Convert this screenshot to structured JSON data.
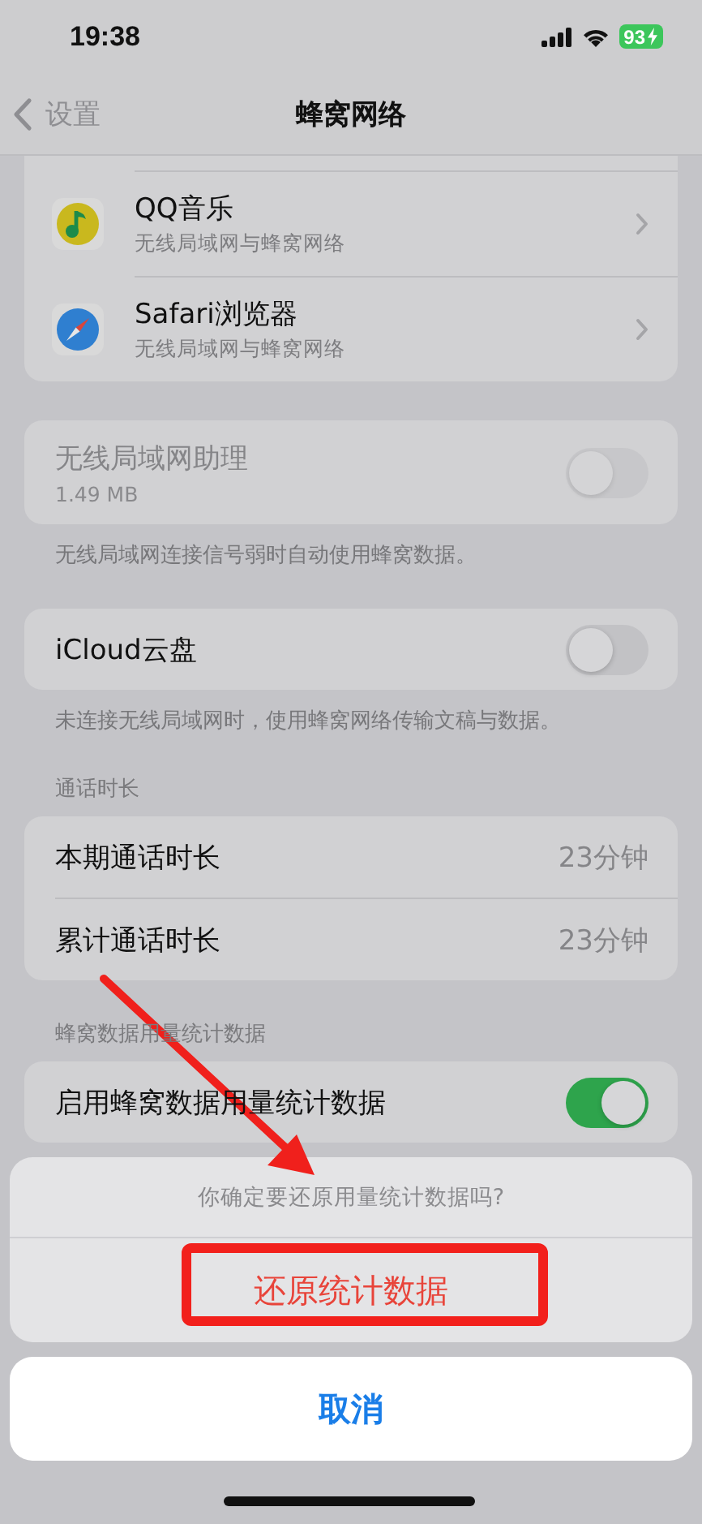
{
  "status_bar": {
    "time": "19:38",
    "battery": "93"
  },
  "nav": {
    "back": "设置",
    "title": "蜂窝网络"
  },
  "apps": [
    {
      "name": "QQ音乐",
      "subtitle": "无线局域网与蜂窝网络",
      "kind": "music"
    },
    {
      "name": "Safari浏览器",
      "subtitle": "无线局域网与蜂窝网络",
      "kind": "compass"
    }
  ],
  "sections": [
    {
      "rows": [
        {
          "kind": "toggle",
          "label": "无线局域网助理",
          "detail": "1.49 MB",
          "on": false,
          "disabled": true
        }
      ],
      "footer": "无线局域网连接信号弱时自动使用蜂窝数据。"
    },
    {
      "rows": [
        {
          "kind": "toggle",
          "label": "iCloud云盘",
          "on": false,
          "disabled": false
        }
      ],
      "footer": "未连接无线局域网时，使用蜂窝网络传输文稿与数据。"
    },
    {
      "header": "通话时长",
      "rows": [
        {
          "kind": "value",
          "label": "本期通话时长",
          "value": "23分钟"
        },
        {
          "kind": "value",
          "label": "累计通话时长",
          "value": "23分钟"
        }
      ]
    },
    {
      "header": "蜂窝数据用量统计数据",
      "rows": [
        {
          "kind": "toggle",
          "label": "启用蜂窝数据用量统计数据",
          "on": true,
          "disabled": false
        }
      ]
    }
  ],
  "action_sheet": {
    "message": "你确定要还原用量统计数据吗?",
    "action": "还原统计数据",
    "cancel": "取消"
  }
}
